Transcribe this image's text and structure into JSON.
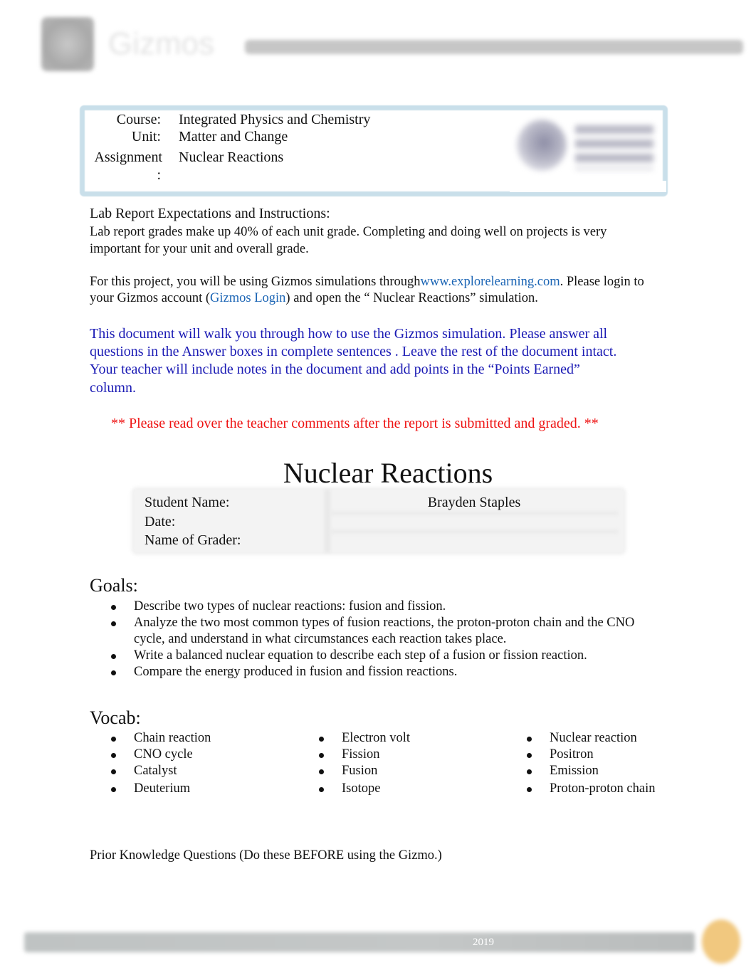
{
  "header": {
    "logo_text": "Gizmos"
  },
  "info": {
    "rows": [
      {
        "label": "Course:",
        "value": "Integrated Physics and Chemistry"
      },
      {
        "label": "Unit:",
        "value": "Matter and Change"
      },
      {
        "label": "Assignment",
        "label_cont": ":",
        "value": "Nuclear Reactions"
      }
    ]
  },
  "instructions": {
    "heading": "Lab Report Expectations and Instructions:",
    "para1_line1": "Lab report grades make up 40% of each unit grade.  Completing and doing well on projects is very",
    "para1_line2": "important for your unit and overall grade.",
    "para2_pre": "For this project, you will be using Gizmos simulations through",
    "para2_link": "www.explorelearning.com",
    "para2_post": ".  Please login to",
    "para2_line2_pre": "your Gizmos account (",
    "para2_line2_link": "Gizmos Login",
    "para2_line2_post": ") and open the “ Nuclear Reactions” simulation.",
    "blue_lines": [
      "This document will walk you through how to use the Gizmos simulation.    Please answer all",
      "questions in the Answer boxes in complete sentences    .  Leave the rest of the document intact.",
      "Your teacher will include notes in the document and add points in the “Points Earned”",
      "column."
    ],
    "red_note": "** Please read over the teacher comments after the report is submitted and graded. **"
  },
  "document": {
    "title": "Nuclear Reactions",
    "student_table": [
      {
        "label": "Student Name:",
        "value": "Brayden Staples"
      },
      {
        "label": "Date:",
        "value": ""
      },
      {
        "label": "Name of Grader:",
        "value": ""
      }
    ]
  },
  "goals": {
    "heading": "Goals:",
    "items": [
      [
        "Describe two types of nuclear reactions: fusion and fission."
      ],
      [
        "Analyze the two most common types of fusion reactions, the proton-proton chain and the CNO",
        "cycle, and understand in what circumstances each reaction takes place."
      ],
      [
        "Write a balanced nuclear equation to describe each step of a fusion or fission reaction."
      ],
      [
        "Compare the energy produced in fusion and fission reactions."
      ]
    ]
  },
  "vocab": {
    "heading": "Vocab:",
    "columns": [
      [
        "Chain reaction",
        "CNO cycle",
        "Catalyst",
        "Deuterium"
      ],
      [
        "Electron volt",
        "Fission",
        "Fusion",
        "Isotope"
      ],
      [
        "Nuclear reaction",
        "Positron",
        "Emission",
        "Proton-proton chain"
      ]
    ]
  },
  "prior_knowledge": {
    "heading": "Prior Knowledge Questions",
    "note": "(Do these BEFORE using the Gizmo.)"
  },
  "footer": {
    "year": "2019"
  },
  "colors": {
    "link": "#1a64b4",
    "instruction_blue": "#1a1ab4",
    "note_red": "#ee1111",
    "box_border": "#c9dfea"
  }
}
